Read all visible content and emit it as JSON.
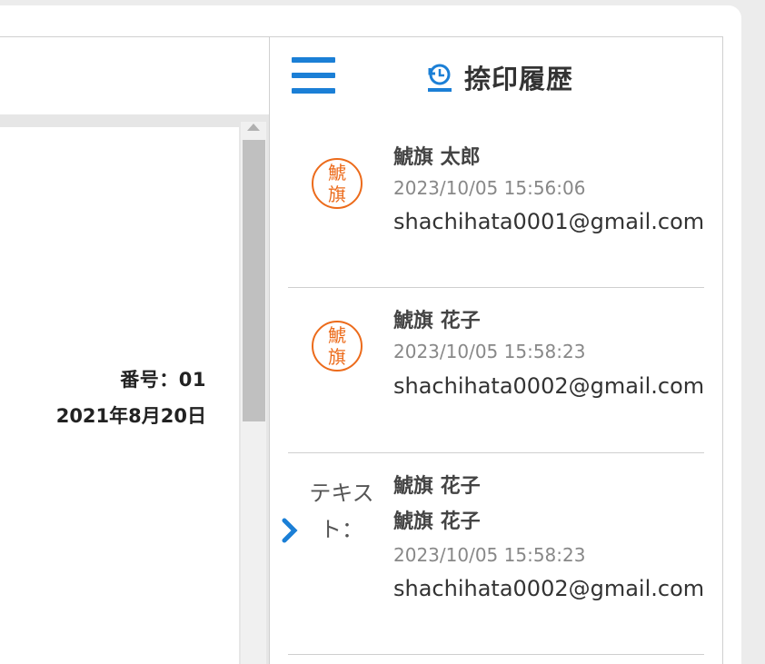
{
  "document": {
    "number": "番号：01",
    "date": "2021年8月20日"
  },
  "panel": {
    "title": "捺印履歴",
    "entries": [
      {
        "stamp": "鯱旗",
        "name": "鯱旗 太郎",
        "timestamp": "2023/10/05 15:56:06",
        "email": "shachihata0001@gmail.com"
      },
      {
        "stamp": "鯱旗",
        "name": "鯱旗 花子",
        "timestamp": "2023/10/05 15:58:23",
        "email": "shachihata0002@gmail.com"
      },
      {
        "text_label": "テキスト：",
        "text_value": "鯱旗 花子",
        "name": "鯱旗 花子",
        "timestamp": "2023/10/05 15:58:23",
        "email": "shachihata0002@gmail.com"
      }
    ]
  },
  "colors": {
    "accent": "#1b7fd6",
    "stamp": "#ec6b1b"
  }
}
